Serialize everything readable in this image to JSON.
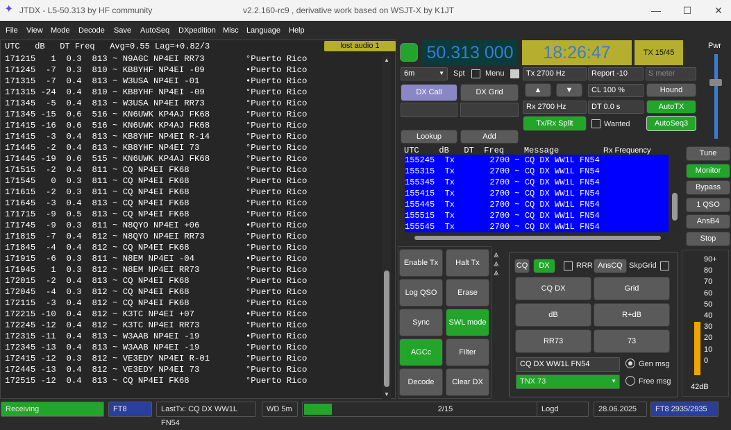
{
  "window": {
    "title": "JTDX - L5-50.313  by HF community",
    "subtitle": "v2.2.160-rc9 , derivative work based on WSJT-X by K1JT"
  },
  "menu": [
    "File",
    "View",
    "Mode",
    "Decode",
    "Save",
    "AutoSeq",
    "DXpedition",
    "Misc",
    "Language",
    "Help"
  ],
  "band_activity": {
    "header": "UTC   dB   DT Freq   Avg=0.55 Lag=+0.82/3",
    "lost_audio": "lost audio 1",
    "rows": [
      "171215   1  0.3  813 ~ N9AGC NP4EI RR73        °Puerto Rico",
      "171245  -7  0.3  810 ~ KB8YHF NP4EI -09        •Puerto Rico",
      "171315  -7  0.4  813 ~ W3USA NP4EI -01         •Puerto Rico",
      "171315 -24  0.4  810 ~ KB8YHF NP4EI -09        °Puerto Rico",
      "171345  -5  0.4  813 ~ W3USA NP4EI RR73        °Puerto Rico",
      "171345 -15  0.6  516 ~ KN6UWK KP4AJ FK68       °Puerto Rico",
      "171415 -16  0.6  516 ~ KN6UWK KP4AJ FK68       °Puerto Rico",
      "171415  -3  0.4  813 ~ KB8YHF NP4EI R-14       °Puerto Rico",
      "171445  -2  0.4  813 ~ KB8YHF NP4EI 73         °Puerto Rico",
      "171445 -19  0.6  515 ~ KN6UWK KP4AJ FK68       °Puerto Rico",
      "171515  -2  0.4  811 ~ CQ NP4EI FK68           °Puerto Rico",
      "171545   0  0.3  811 ~ CQ NP4EI FK68           °Puerto Rico",
      "171615  -2  0.3  811 ~ CQ NP4EI FK68           °Puerto Rico",
      "171645  -3  0.4  813 ~ CQ NP4EI FK68           °Puerto Rico",
      "171715  -9  0.5  813 ~ CQ NP4EI FK68           °Puerto Rico",
      "171745  -9  0.3  811 ~ N8QYO NP4EI +06         •Puerto Rico",
      "171815  -7  0.4  812 ~ N8QYO NP4EI RR73        °Puerto Rico",
      "171845  -4  0.4  812 ~ CQ NP4EI FK68           °Puerto Rico",
      "171915  -6  0.3  811 ~ N8EM NP4EI -04          •Puerto Rico",
      "171945   1  0.3  812 ~ N8EM NP4EI RR73         °Puerto Rico",
      "172015  -2  0.4  813 ~ CQ NP4EI FK68           °Puerto Rico",
      "172045  -4  0.3  812 ~ CQ NP4EI FK68           °Puerto Rico",
      "172115  -3  0.4  812 ~ CQ NP4EI FK68           °Puerto Rico",
      "172215 -10  0.4  812 ~ K3TC NP4EI +07          •Puerto Rico",
      "172245 -12  0.4  812 ~ K3TC NP4EI RR73         °Puerto Rico",
      "172315 -11  0.4  813 ~ W3AAB NP4EI -19         •Puerto Rico",
      "172345 -13  0.4  813 ~ W3AAB NP4EI -19         °Puerto Rico",
      "172415 -12  0.3  812 ~ VE3EDY NP4EI R-01       °Puerto Rico",
      "172445 -13  0.4  812 ~ VE3EDY NP4EI 73         °Puerto Rico",
      "172515 -12  0.4  813 ~ CQ NP4EI FK68           °Puerto Rico"
    ]
  },
  "controls": {
    "frequency": "50.313 000",
    "clock": "18:26:47",
    "tx_period": "TX 15/45",
    "pwr_label": "Pwr",
    "band": "6m",
    "spt_label": "Spt",
    "menu_label": "Menu",
    "dx_call": "DX Call",
    "dx_grid": "DX Grid",
    "lookup": "Lookup",
    "add": "Add",
    "tx_freq": "Tx  2700  Hz",
    "rx_freq": "Rx  2700  Hz",
    "report": "Report -10",
    "s_meter": "S meter",
    "cl": "CL  100 %",
    "dt": "DT 0.0 s",
    "hound": "Hound",
    "autotx": "AutoTX",
    "autoseq": "AutoSeq3",
    "txrx_split": "Tx/Rx Split",
    "wanted": "Wanted",
    "up_arrow": "▲",
    "down_arrow": "▼"
  },
  "rx_frequency": {
    "header": "UTC    dB   DT  Freq    Message",
    "header_right": "Rx Frequency",
    "rows": [
      "155245  Tx       2700 ~ CQ DX WW1L FN54",
      "155315  Tx       2700 ~ CQ DX WW1L FN54",
      "155345  Tx       2700 ~ CQ DX WW1L FN54",
      "155415  Tx       2700 ~ CQ DX WW1L FN54",
      "155445  Tx       2700 ~ CQ DX WW1L FN54",
      "155515  Tx       2700 ~ CQ DX WW1L FN54",
      "155545  Tx       2700 ~ CQ DX WW1L FN54"
    ]
  },
  "right_buttons": [
    "Tune",
    "Monitor",
    "Bypass",
    "1 QSO",
    "AnsB4",
    "Stop"
  ],
  "action_buttons": [
    [
      "Enable Tx",
      "Halt Tx"
    ],
    [
      "Log QSO",
      "Erase"
    ],
    [
      "Sync",
      "SWL mode"
    ],
    [
      "AGCc",
      "Filter"
    ],
    [
      "Decode",
      "Clear DX"
    ]
  ],
  "tx_panel": {
    "cq": "CQ",
    "dx": "DX",
    "rrr": "RRR",
    "anscq": "AnsCQ",
    "skpgrid": "SkpGrid",
    "buttons": [
      [
        "CQ DX",
        "Grid"
      ],
      [
        "dB",
        "R+dB"
      ],
      [
        "RR73",
        "73"
      ]
    ],
    "gen_msg_text": "CQ DX WW1L FN54",
    "gen_msg": "Gen msg",
    "free_msg_text": "TNX 73",
    "free_msg": "Free msg"
  },
  "meter": {
    "labels": [
      "90+",
      "80",
      "70",
      "60",
      "50",
      "40",
      "30",
      "20",
      "10",
      "0"
    ],
    "level_db": "42dB",
    "level": 42
  },
  "statusbar": {
    "state": "Receiving",
    "mode": "FT8",
    "last_tx": "LastTx: CQ DX WW1L FN54",
    "wd": "WD 5m",
    "progress": "2/15",
    "logd": "Logd",
    "date": "28.06.2025",
    "decodes": "FT8  2935/2935"
  }
}
